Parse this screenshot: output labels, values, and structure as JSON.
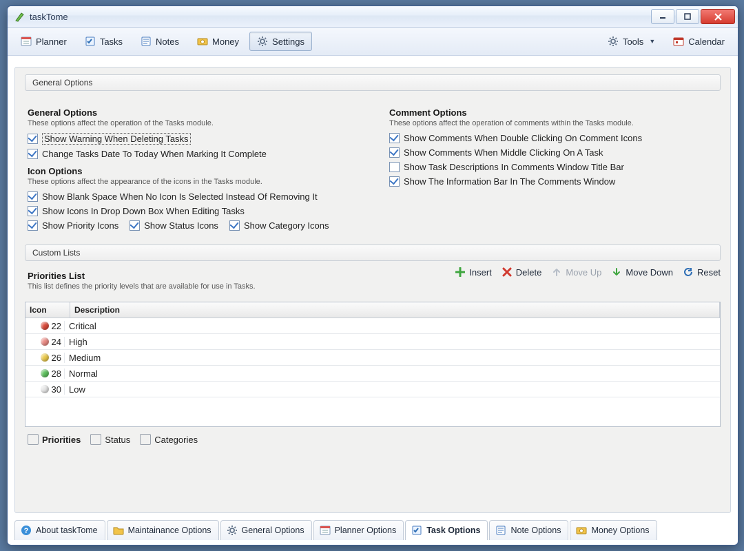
{
  "window": {
    "title": "taskTome"
  },
  "toolbar": {
    "items": [
      {
        "label": "Planner",
        "icon": "planner"
      },
      {
        "label": "Tasks",
        "icon": "tasks"
      },
      {
        "label": "Notes",
        "icon": "notes"
      },
      {
        "label": "Money",
        "icon": "money"
      },
      {
        "label": "Settings",
        "icon": "settings",
        "active": true
      }
    ],
    "right": [
      {
        "label": "Tools",
        "icon": "gear",
        "dropdown": true
      },
      {
        "label": "Calendar",
        "icon": "calendar"
      }
    ]
  },
  "groups": {
    "general_title": "General Options",
    "custom_title": "Custom Lists"
  },
  "general": {
    "heading": "General Options",
    "sub": "These options affect the operation of the Tasks module.",
    "items": [
      {
        "label": "Show Warning When Deleting Tasks",
        "checked": true,
        "focused": true
      },
      {
        "label": "Change Tasks Date To Today When Marking It Complete",
        "checked": true
      }
    ]
  },
  "iconopts": {
    "heading": "Icon Options",
    "sub": "These options affect the appearance of the icons in the Tasks module.",
    "items": [
      {
        "label": "Show Blank Space When No Icon Is Selected Instead Of Removing It",
        "checked": true
      },
      {
        "label": "Show Icons In Drop Down Box When Editing Tasks",
        "checked": true
      }
    ],
    "inline": [
      {
        "label": "Show Priority Icons",
        "checked": true
      },
      {
        "label": "Show Status Icons",
        "checked": true
      },
      {
        "label": "Show Category Icons",
        "checked": true
      }
    ]
  },
  "comments": {
    "heading": "Comment Options",
    "sub": "These options affect the operation of comments within the Tasks module.",
    "items": [
      {
        "label": "Show Comments When Double Clicking On Comment Icons",
        "checked": true
      },
      {
        "label": "Show Comments When Middle Clicking On A Task",
        "checked": true
      },
      {
        "label": "Show Task Descriptions In Comments Window Title Bar",
        "checked": false
      },
      {
        "label": "Show The Information Bar In The Comments Window",
        "checked": true
      }
    ]
  },
  "priorities": {
    "heading": "Priorities List",
    "sub": "This list defines the priority levels that are available for use in Tasks.",
    "actions": {
      "insert": "Insert",
      "delete": "Delete",
      "moveup": "Move Up",
      "movedown": "Move Down",
      "reset": "Reset"
    },
    "columns": {
      "icon": "Icon",
      "desc": "Description"
    },
    "rows": [
      {
        "num": "22",
        "desc": "Critical",
        "color": "#d94a3a"
      },
      {
        "num": "24",
        "desc": "High",
        "color": "#e98a84"
      },
      {
        "num": "26",
        "desc": "Medium",
        "color": "#e9c84a"
      },
      {
        "num": "28",
        "desc": "Normal",
        "color": "#5cbf5c"
      },
      {
        "num": "30",
        "desc": "Low",
        "color": "#e4e4e4"
      }
    ],
    "subtabs": [
      {
        "label": "Priorities",
        "active": true
      },
      {
        "label": "Status"
      },
      {
        "label": "Categories"
      }
    ]
  },
  "bottomtabs": [
    {
      "label": "About taskTome",
      "icon": "help"
    },
    {
      "label": "Maintainance Options",
      "icon": "folder"
    },
    {
      "label": "General Options",
      "icon": "gear"
    },
    {
      "label": "Planner Options",
      "icon": "planner"
    },
    {
      "label": "Task Options",
      "icon": "tasks",
      "active": true
    },
    {
      "label": "Note Options",
      "icon": "notes"
    },
    {
      "label": "Money Options",
      "icon": "money"
    }
  ]
}
